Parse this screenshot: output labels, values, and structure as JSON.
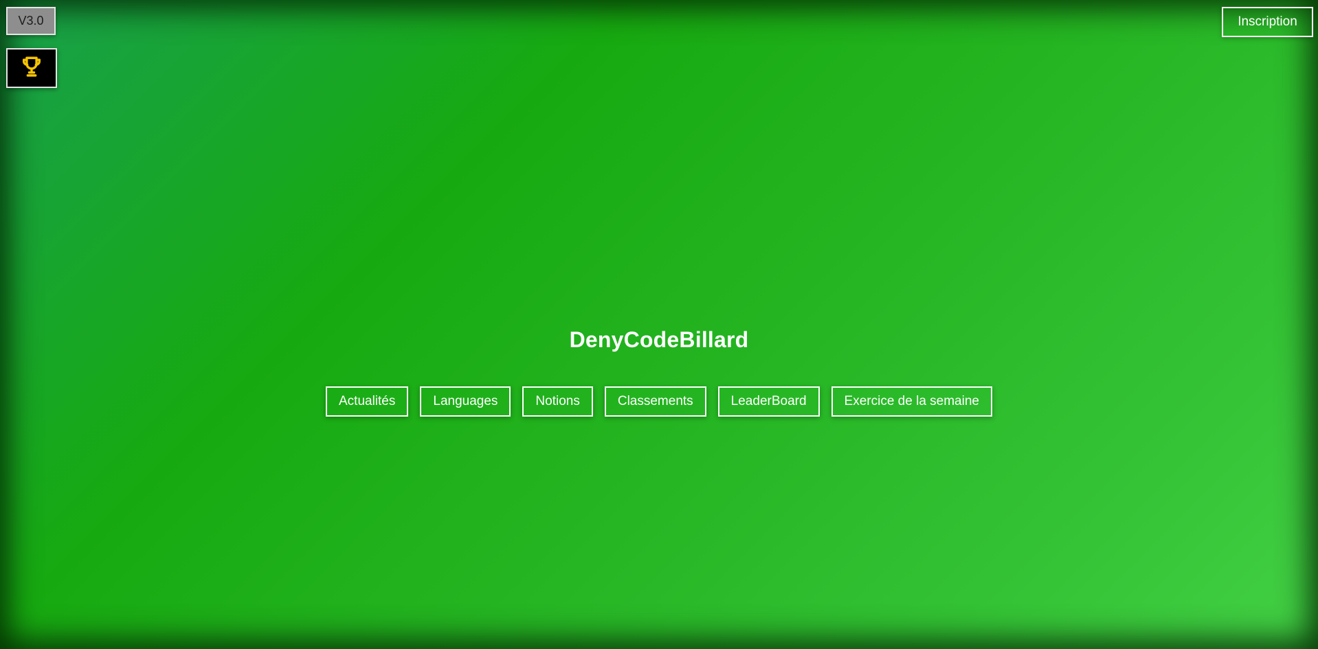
{
  "header": {
    "version_label": "V3.0",
    "trophy_icon": "trophy-icon",
    "trophy_color": "#f5c400",
    "signup_label": "Inscription"
  },
  "main": {
    "title": "DenyCodeBillard",
    "nav": [
      {
        "label": "Actualités"
      },
      {
        "label": "Languages"
      },
      {
        "label": "Notions"
      },
      {
        "label": "Classements"
      },
      {
        "label": "LeaderBoard"
      },
      {
        "label": "Exercice de la semaine"
      }
    ]
  },
  "colors": {
    "background_start": "#19a04c",
    "background_mid": "#17aa10",
    "background_end": "#43d045",
    "button_border": "#ffffff",
    "version_bg": "#8e8e8e"
  }
}
